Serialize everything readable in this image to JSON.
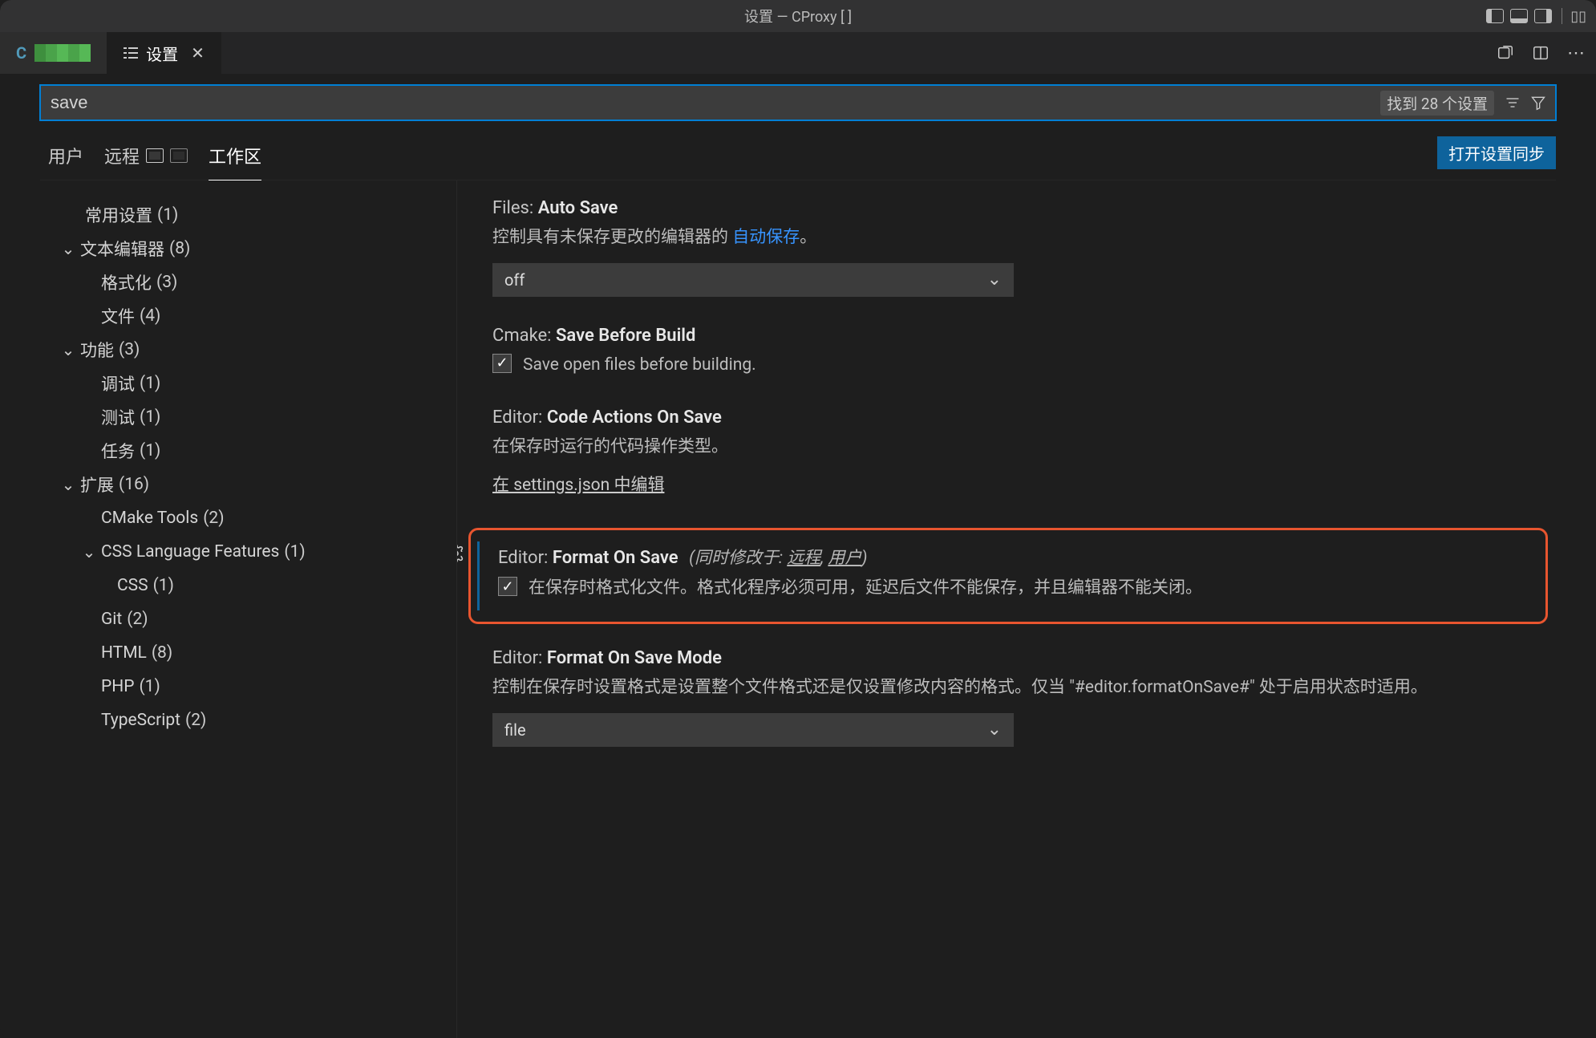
{
  "titlebar": {
    "title": "设置 — CProxy [        ]"
  },
  "tabs": {
    "file_tab": {
      "icon": "C"
    },
    "settings_tab": {
      "label": "设置"
    }
  },
  "search": {
    "value": "save",
    "result_count": "找到 28 个设置"
  },
  "scope": {
    "user": "用户",
    "remote": "远程",
    "workspace": "工作区",
    "sync_button": "打开设置同步"
  },
  "outline": [
    {
      "label": "常用设置",
      "count": "(1)",
      "indent": "ind1"
    },
    {
      "label": "文本编辑器",
      "count": "(8)",
      "indent": "ind2c",
      "chev": true
    },
    {
      "label": "格式化",
      "count": "(3)",
      "indent": "ind3"
    },
    {
      "label": "文件",
      "count": "(4)",
      "indent": "ind3"
    },
    {
      "label": "功能",
      "count": "(3)",
      "indent": "ind2c",
      "chev": true
    },
    {
      "label": "调试",
      "count": "(1)",
      "indent": "ind3"
    },
    {
      "label": "测试",
      "count": "(1)",
      "indent": "ind3"
    },
    {
      "label": "任务",
      "count": "(1)",
      "indent": "ind3"
    },
    {
      "label": "扩展",
      "count": "(16)",
      "indent": "ind2c",
      "chev": true
    },
    {
      "label": "CMake Tools",
      "count": "(2)",
      "indent": "ind3"
    },
    {
      "label": "CSS Language Features",
      "count": "(1)",
      "indent": "ind3",
      "chev": true,
      "chev_offset": true
    },
    {
      "label": "CSS",
      "count": "(1)",
      "indent": "ind4"
    },
    {
      "label": "Git",
      "count": "(2)",
      "indent": "ind3"
    },
    {
      "label": "HTML",
      "count": "(8)",
      "indent": "ind3"
    },
    {
      "label": "PHP",
      "count": "(1)",
      "indent": "ind3"
    },
    {
      "label": "TypeScript",
      "count": "(2)",
      "indent": "ind3"
    }
  ],
  "settings": {
    "auto_save": {
      "scope": "Files:",
      "name": "Auto Save",
      "desc_prefix": "控制具有未保存更改的编辑器的 ",
      "desc_link": "自动保存",
      "desc_suffix": "。",
      "value": "off"
    },
    "save_before_build": {
      "scope": "Cmake:",
      "name": "Save Before Build",
      "check_label": "Save open files before building."
    },
    "code_actions": {
      "scope": "Editor:",
      "name": "Code Actions On Save",
      "desc": "在保存时运行的代码操作类型。",
      "edit_link": "在 settings.json 中编辑"
    },
    "format_on_save": {
      "scope": "Editor:",
      "name": "Format On Save",
      "modified_prefix": "(同时修改于: ",
      "modified_1": "远程",
      "modified_sep": ", ",
      "modified_2": "用户",
      "modified_suffix": ")",
      "check_label": "在保存时格式化文件。格式化程序必须可用，延迟后文件不能保存，并且编辑器不能关闭。"
    },
    "format_on_save_mode": {
      "scope": "Editor:",
      "name": "Format On Save Mode",
      "desc": "控制在保存时设置格式是设置整个文件格式还是仅设置修改内容的格式。仅当 \"#editor.formatOnSave#\" 处于启用状态时适用。",
      "value": "file"
    }
  }
}
